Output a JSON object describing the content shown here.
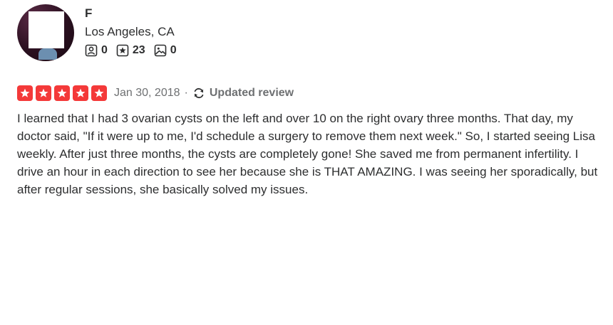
{
  "user": {
    "name": "F",
    "location": "Los Angeles, CA",
    "stats": {
      "friends": "0",
      "reviews": "23",
      "photos": "0"
    }
  },
  "review": {
    "rating": 5,
    "max_rating": 5,
    "date": "Jan 30, 2018",
    "separator": "·",
    "updated_label": "Updated review",
    "text": "I learned that I had 3 ovarian cysts on the left and over 10 on the right ovary three months. That day, my doctor said, \"If it were up to me, I'd schedule a surgery to remove them next week.\" So, I started seeing Lisa weekly. After just three months, the cysts are completely gone! She saved me from permanent infertility. I drive an hour in each direction to see her because she is THAT AMAZING. I was seeing her sporadically, but after regular sessions, she basically solved my issues."
  },
  "colors": {
    "star_red": "#f43939",
    "text_dark": "#2d2e2f",
    "text_muted": "#6e7072"
  },
  "icons": {
    "friends": "friends-icon",
    "reviews": "star-review-icon",
    "photos": "photo-icon",
    "updated": "refresh-icon",
    "star": "star-icon"
  }
}
